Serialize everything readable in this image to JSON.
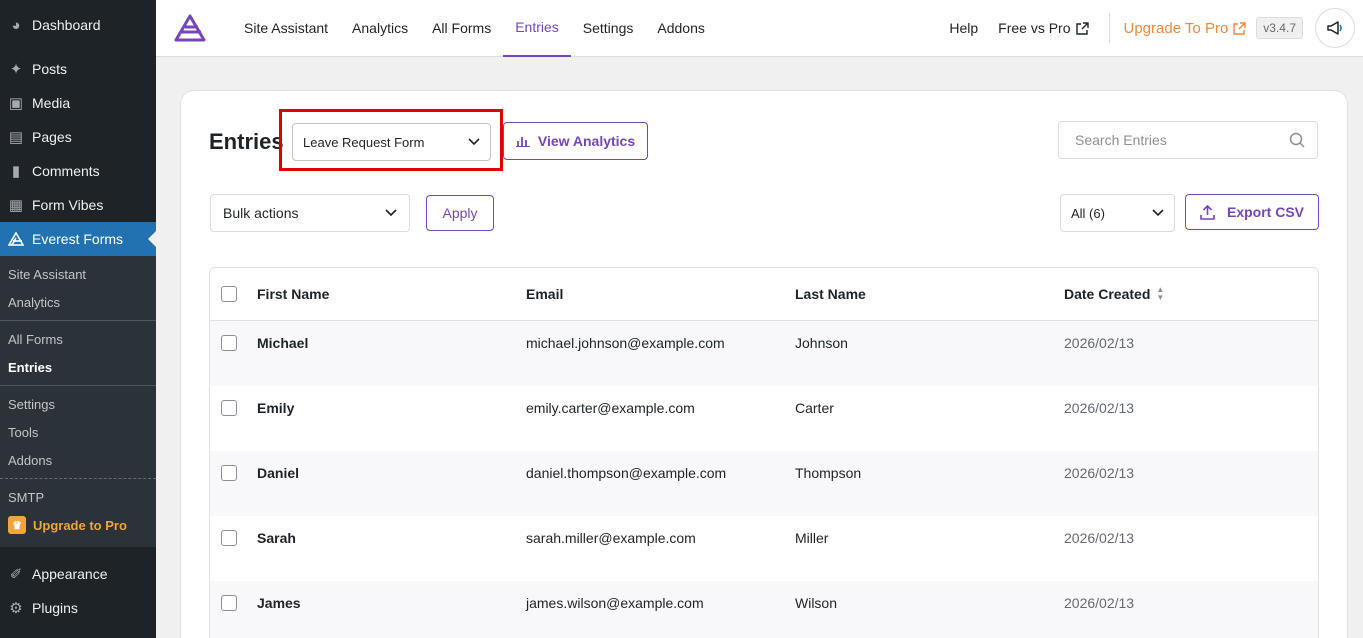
{
  "sidebar": {
    "items_top": [
      {
        "label": "Dashboard",
        "icon": "dashboard-icon"
      },
      {
        "label": "Posts",
        "icon": "pin-icon"
      },
      {
        "label": "Media",
        "icon": "media-icon"
      },
      {
        "label": "Pages",
        "icon": "pages-icon"
      },
      {
        "label": "Comments",
        "icon": "comments-icon"
      },
      {
        "label": "Form Vibes",
        "icon": "form-vibes-icon"
      },
      {
        "label": "Everest Forms",
        "icon": "everest-forms-icon"
      }
    ],
    "sub": {
      "site_assistant": "Site Assistant",
      "analytics": "Analytics",
      "all_forms": "All Forms",
      "entries": "Entries",
      "settings": "Settings",
      "tools": "Tools",
      "addons": "Addons",
      "smtp": "SMTP",
      "upgrade": "Upgrade to Pro"
    },
    "items_bottom": [
      {
        "label": "Appearance",
        "icon": "appearance-icon"
      },
      {
        "label": "Plugins",
        "icon": "plugins-icon"
      }
    ]
  },
  "topbar": {
    "tabs": [
      "Site Assistant",
      "Analytics",
      "All Forms",
      "Entries",
      "Settings",
      "Addons"
    ],
    "active_tab": "Entries",
    "help": "Help",
    "free_vs_pro": "Free vs Pro",
    "upgrade": "Upgrade To Pro",
    "version": "v3.4.7"
  },
  "main": {
    "title": "Entries",
    "form_select": "Leave Request Form",
    "view_analytics": "View Analytics",
    "search_placeholder": "Search Entries",
    "bulk_actions": "Bulk actions",
    "apply": "Apply",
    "filter": "All (6)",
    "export": "Export CSV"
  },
  "table": {
    "headers": [
      "First Name",
      "Email",
      "Last Name",
      "Date Created"
    ],
    "rows": [
      [
        "Michael",
        "michael.johnson@example.com",
        "Johnson",
        "2026/02/13"
      ],
      [
        "Emily",
        "emily.carter@example.com",
        "Carter",
        "2026/02/13"
      ],
      [
        "Daniel",
        "daniel.thompson@example.com",
        "Thompson",
        "2026/02/13"
      ],
      [
        "Sarah",
        "sarah.miller@example.com",
        "Miller",
        "2026/02/13"
      ],
      [
        "James",
        "james.wilson@example.com",
        "Wilson",
        "2026/02/13"
      ]
    ]
  },
  "colors": {
    "accent": "#7545bb",
    "wp_blue": "#2271b1",
    "upgrade_orange": "#f0883a",
    "highlight_red": "#e00000"
  }
}
